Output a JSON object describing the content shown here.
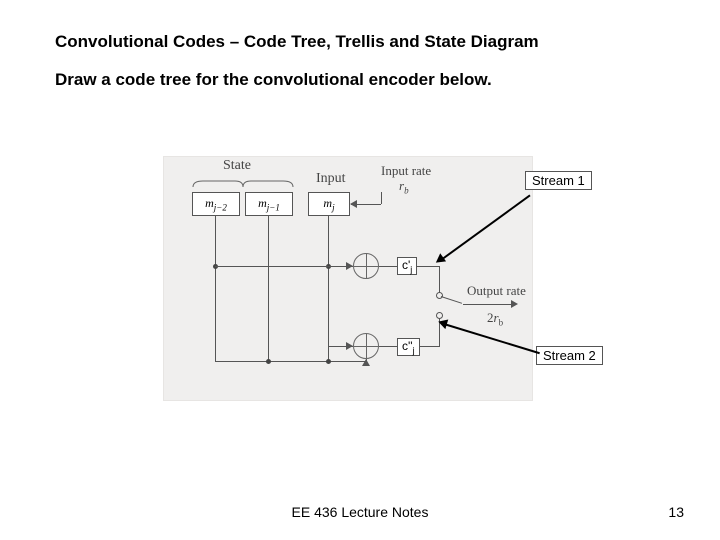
{
  "title": "Convolutional Codes – Code Tree, Trellis and State Diagram",
  "prompt": "Draw a code tree for the convolutional encoder below.",
  "labels": {
    "state": "State",
    "input": "Input",
    "input_rate": "Input rate",
    "rb": "r_b",
    "output_rate": "Output rate",
    "two_rb": "2r_b",
    "regs": {
      "m_jm2": "m_{j-2}",
      "m_jm1": "m_{j-1}",
      "m_j": "m_j"
    },
    "c1": "c'",
    "c1_sub": "j",
    "c2": "c''",
    "c2_sub": "j",
    "stream1": "Stream 1",
    "stream2": "Stream 2"
  },
  "footer": "EE 436 Lecture Notes",
  "page": "13",
  "chart_data": {
    "type": "diagram",
    "encoder": {
      "kind": "convolutional",
      "rate": "1/2",
      "constraint_length": 3,
      "shift_register": [
        "m_j",
        "m_{j-1}",
        "m_{j-2}"
      ],
      "outputs": [
        {
          "name": "c'_j",
          "stream": 1,
          "xor_taps": [
            "m_j",
            "m_{j-2}"
          ]
        },
        {
          "name": "c''_j",
          "stream": 2,
          "xor_taps": [
            "m_j",
            "m_{j-1}",
            "m_{j-2}"
          ]
        }
      ],
      "input_rate": "r_b",
      "output_rate": "2*r_b",
      "commutator": "alternates c'_j and c''_j into serial output"
    }
  }
}
